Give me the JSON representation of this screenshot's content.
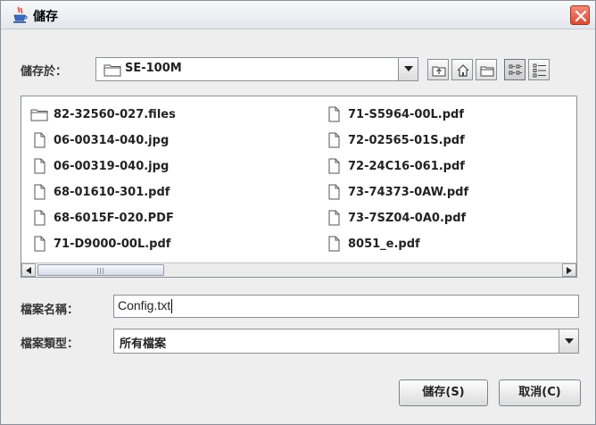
{
  "window": {
    "title": "儲存"
  },
  "look_in": {
    "label": "儲存於：",
    "value": "SE-100M"
  },
  "toolbar": {
    "buttons": [
      {
        "name": "up-one-level",
        "icon": "up-folder-icon"
      },
      {
        "name": "home",
        "icon": "home-icon"
      },
      {
        "name": "new-folder",
        "icon": "new-folder-icon"
      },
      {
        "name": "list-view",
        "icon": "list-view-icon",
        "active": true
      },
      {
        "name": "details-view",
        "icon": "details-view-icon"
      }
    ]
  },
  "files": {
    "left": [
      {
        "name": "82-32560-027.files",
        "type": "folder"
      },
      {
        "name": "06-00314-040.jpg",
        "type": "file"
      },
      {
        "name": "06-00319-040.jpg",
        "type": "file"
      },
      {
        "name": "68-01610-301.pdf",
        "type": "file"
      },
      {
        "name": "68-6015F-020.PDF",
        "type": "file"
      },
      {
        "name": "71-D9000-00L.pdf",
        "type": "file"
      }
    ],
    "right": [
      {
        "name": "71-S5964-00L.pdf",
        "type": "file"
      },
      {
        "name": "72-02565-01S.pdf",
        "type": "file"
      },
      {
        "name": "72-24C16-061.pdf",
        "type": "file"
      },
      {
        "name": "73-74373-0AW.pdf",
        "type": "file"
      },
      {
        "name": "73-7SZ04-0A0.pdf",
        "type": "file"
      },
      {
        "name": "8051_e.pdf",
        "type": "file"
      }
    ]
  },
  "filename": {
    "label": "檔案名稱：",
    "value": "Config.txt"
  },
  "filetype": {
    "label": "檔案類型：",
    "value": "所有檔案"
  },
  "buttons": {
    "save": "儲存(S)",
    "cancel": "取消(C)"
  },
  "colors": {
    "close": "#d94b34",
    "border": "#8b8f96"
  }
}
